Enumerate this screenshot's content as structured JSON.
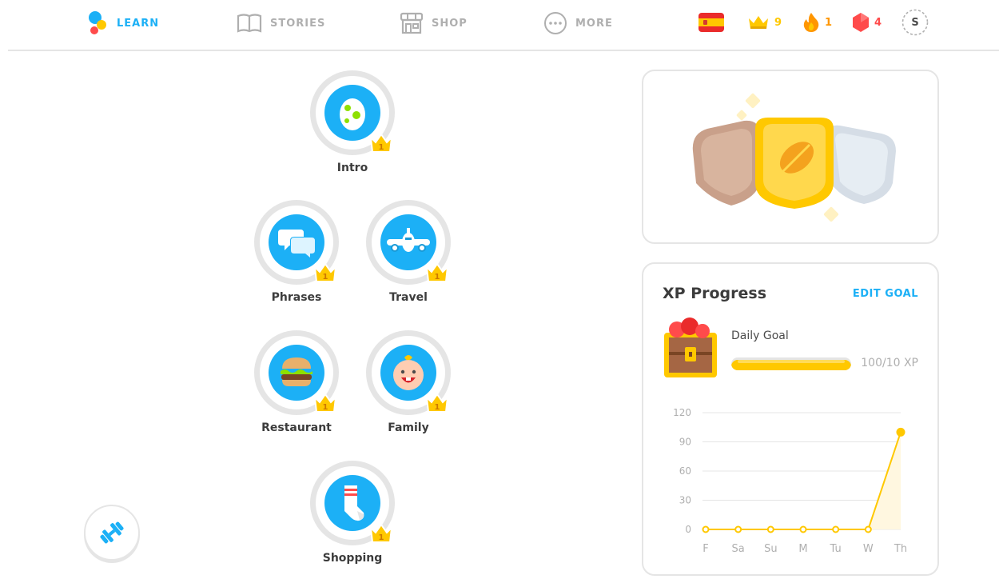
{
  "nav": {
    "learn": "LEARN",
    "stories": "STORIES",
    "shop": "SHOP",
    "more": "MORE"
  },
  "stats": {
    "language_flag": "spanish-flag",
    "crowns": "9",
    "streak": "1",
    "gems": "4",
    "avatar_initial": "S"
  },
  "skills": [
    {
      "label": "Intro",
      "crown_level": "1",
      "icon": "egg-icon"
    },
    {
      "label": "Phrases",
      "crown_level": "1",
      "icon": "speech-bubbles-icon"
    },
    {
      "label": "Travel",
      "crown_level": "1",
      "icon": "airplane-icon"
    },
    {
      "label": "Restaurant",
      "crown_level": "1",
      "icon": "burger-icon"
    },
    {
      "label": "Family",
      "crown_level": "1",
      "icon": "baby-icon"
    },
    {
      "label": "Shopping",
      "crown_level": "1",
      "icon": "sock-icon"
    }
  ],
  "practice": {
    "icon": "dumbbell-icon"
  },
  "league": {
    "icon": "league-shields-icon"
  },
  "xp": {
    "title": "XP Progress",
    "edit_goal": "EDIT GOAL",
    "daily_goal_label": "Daily Goal",
    "goal_text": "100/10 XP",
    "goal_progress": 1.0
  },
  "colors": {
    "accent": "#1cb0f6",
    "gold": "#ffc800",
    "streak": "#ff9600",
    "gem": "#ff4b4b",
    "grey": "#e5e5e5"
  },
  "chart_data": {
    "type": "line",
    "categories": [
      "F",
      "Sa",
      "Su",
      "M",
      "Tu",
      "W",
      "Th"
    ],
    "series": [
      {
        "values": [
          0,
          0,
          0,
          0,
          0,
          0,
          100
        ]
      }
    ],
    "yticks": [
      "0",
      "30",
      "60",
      "90",
      "120"
    ],
    "ylim": [
      0,
      120
    ],
    "grid": true,
    "color": "#ffc800"
  }
}
